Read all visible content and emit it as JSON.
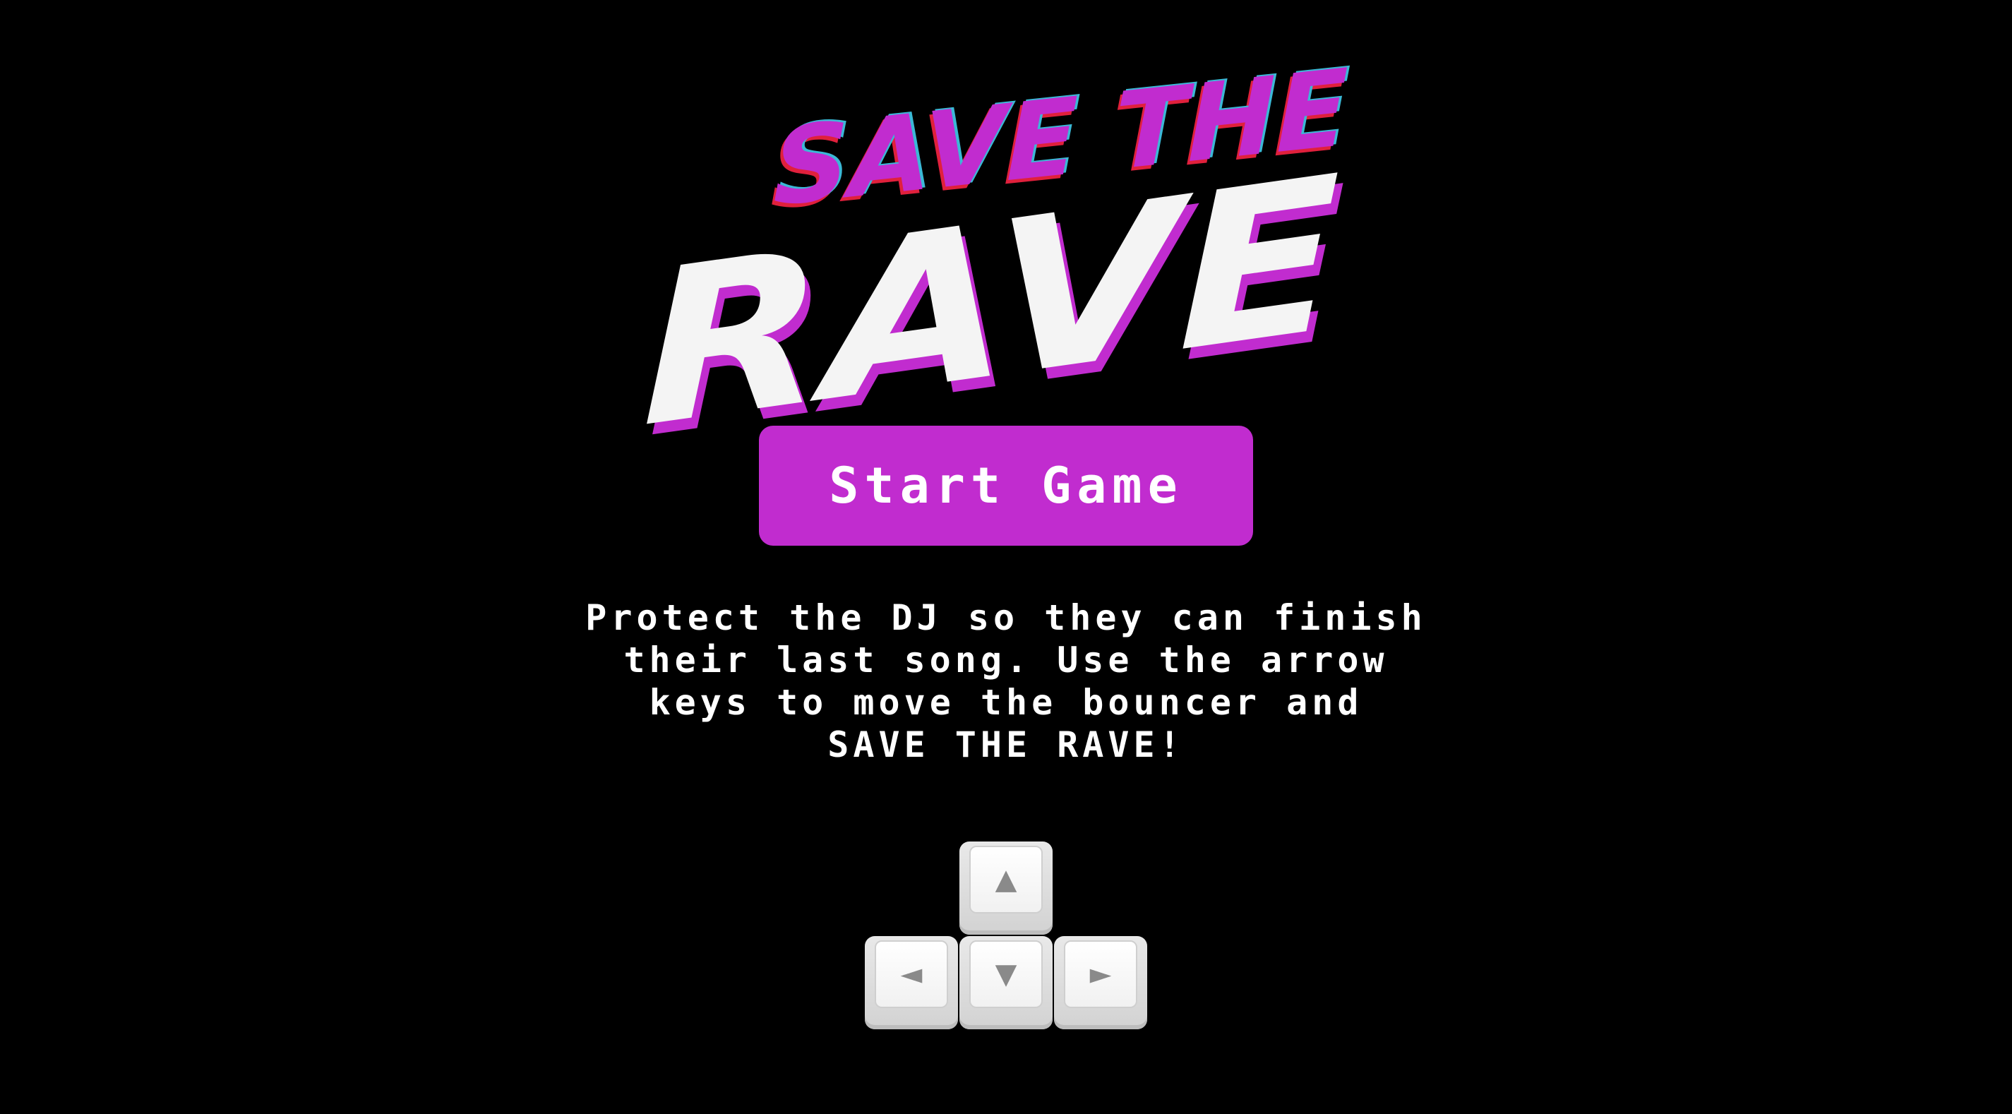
{
  "logo": {
    "line1": "SAVE THE",
    "line2": "RAVE"
  },
  "start_button": {
    "label": "Start Game"
  },
  "instructions": {
    "lines": [
      "Protect the DJ so they can finish",
      "their last song. Use the arrow",
      "keys to move the bouncer and",
      "SAVE THE RAVE!"
    ]
  },
  "arrow_keys": {
    "up": "▲",
    "left": "◄",
    "down": "▼",
    "right": "►"
  },
  "colors": {
    "background": "#000000",
    "accent": "#c12ccf",
    "logo_white": "#f4f4f4",
    "logo_cyan": "#3bb8d6",
    "logo_red": "#e0203c"
  }
}
